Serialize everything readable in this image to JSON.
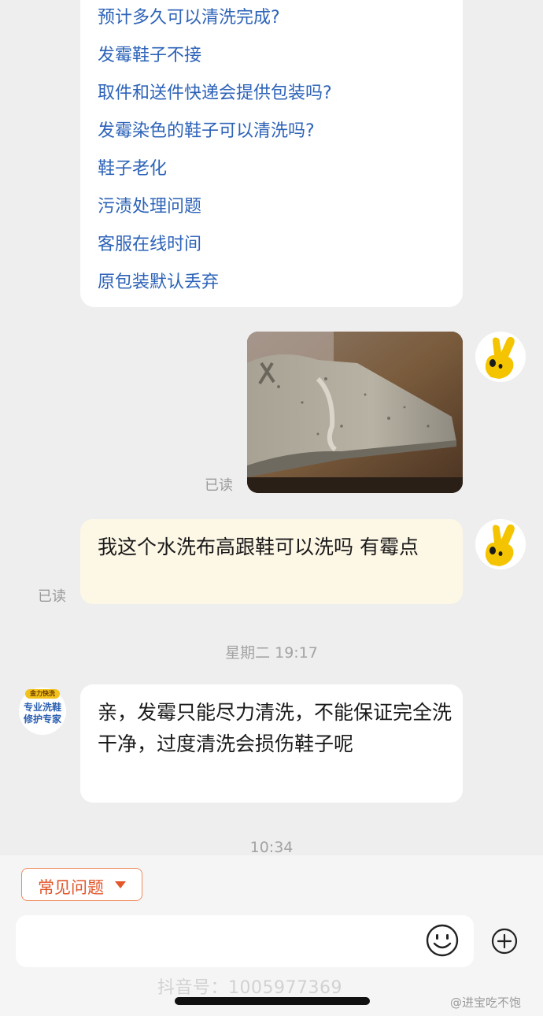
{
  "faq": {
    "items": [
      "预计多久可以清洗完成?",
      "发霉鞋子不接",
      "取件和送件快递会提供包装吗?",
      "发霉染色的鞋子可以清洗吗?",
      "鞋子老化",
      "污渍处理问题",
      "客服在线时间",
      "原包装默认丢弃"
    ]
  },
  "messages": {
    "image_read_status": "已读",
    "user_text": "我这个水洗布高跟鞋可以洗吗 有霉点",
    "user_read_status": "已读",
    "time_divider_1": "星期二 19:17",
    "shop_avatar": {
      "badge": "金力快洗",
      "line1": "专业洗鞋",
      "line2": "修护专家"
    },
    "shop_text": "亲，发霉只能尽力清洗，不能保证完全洗干净，过度清洗会损伤鞋子呢",
    "time_divider_2": "10:34"
  },
  "bottom": {
    "quick_button_label": "常见问题",
    "input_placeholder": "",
    "emoji_icon": "smile-icon",
    "plus_icon": "plus-circle-icon"
  },
  "watermarks": {
    "left": "抖音号：1005977369",
    "right": "@进宝吃不饱"
  },
  "colors": {
    "link_blue": "#2d63b8",
    "accent_orange": "#e2562a",
    "user_bubble": "#fdf7e6",
    "avatar_yellow": "#f5c400"
  }
}
